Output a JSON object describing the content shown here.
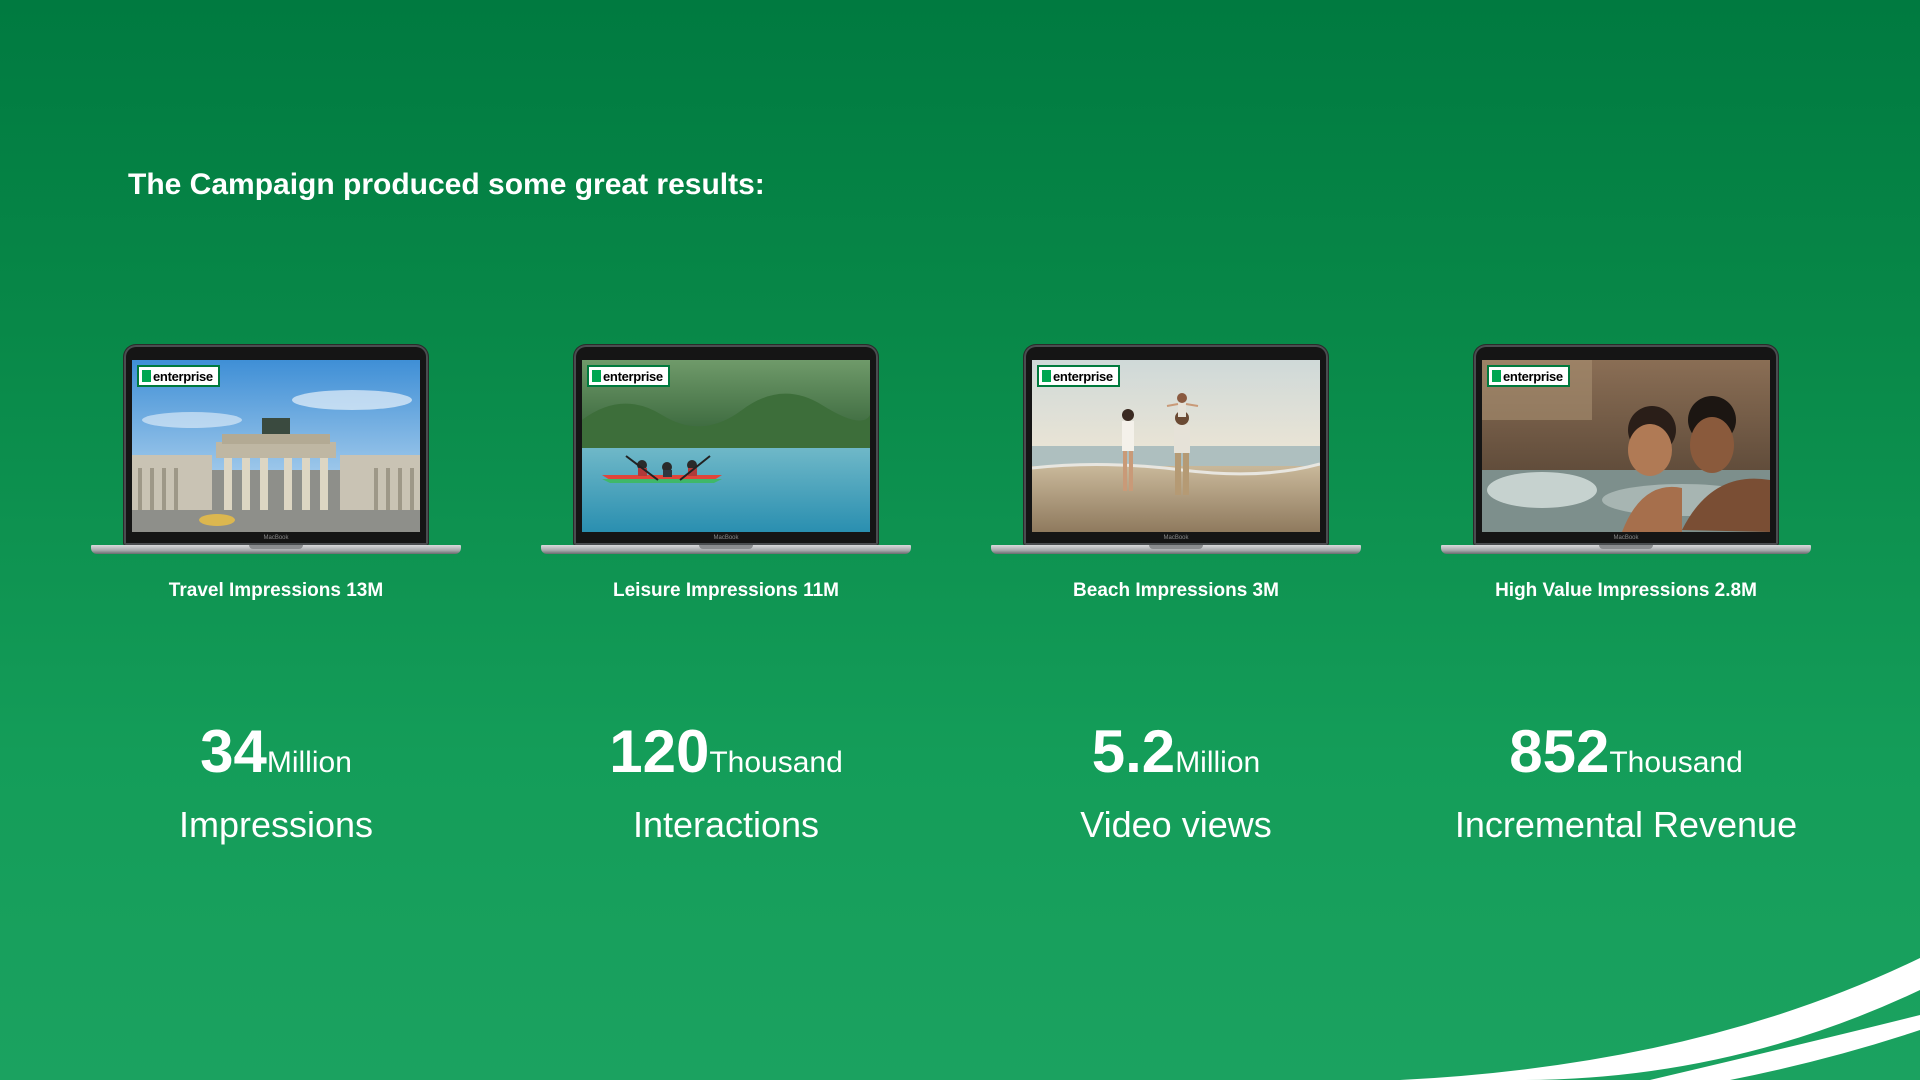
{
  "slide": {
    "headline": "The Campaign produced some great results:"
  },
  "laptops": [
    {
      "caption": "Travel Impressions 13M",
      "logo_text": "enterprise",
      "device_label": "MacBook",
      "scene": "brandenburg-gate-photo"
    },
    {
      "caption": "Leisure Impressions 11M",
      "logo_text": "enterprise",
      "device_label": "MacBook",
      "scene": "kayak-lake-photo"
    },
    {
      "caption": "Beach Impressions 3M",
      "logo_text": "enterprise",
      "device_label": "MacBook",
      "scene": "family-beach-photo"
    },
    {
      "caption": "High Value Impressions 2.8M",
      "logo_text": "enterprise",
      "device_label": "MacBook",
      "scene": "couple-hot-tub-photo"
    }
  ],
  "stats": [
    {
      "value": "34",
      "unit": "Million",
      "label": "Impressions"
    },
    {
      "value": "120",
      "unit": "Thousand",
      "label": "Interactions"
    },
    {
      "value": "5.2",
      "unit": "Million",
      "label": "Video views"
    },
    {
      "value": "852",
      "unit": "Thousand",
      "label": "Incremental Revenue"
    }
  ],
  "colors": {
    "background_top": "#007a40",
    "background_bottom": "#1ba260",
    "text": "#ffffff",
    "brand_green": "#00a651"
  }
}
